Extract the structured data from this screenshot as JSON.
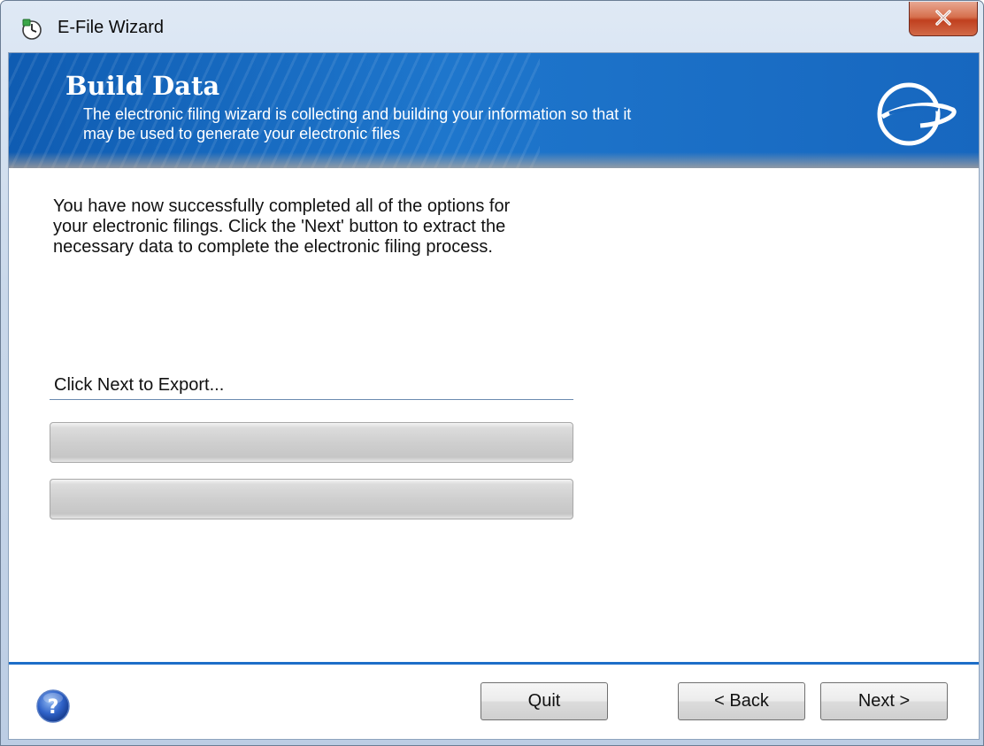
{
  "window": {
    "title": "E-File Wizard",
    "close_glyph": "X"
  },
  "banner": {
    "title": "Build Data",
    "subtitle_line1": "The electronic filing wizard is collecting and building your information so that it",
    "subtitle_line2": "may be used to generate your electronic files",
    "logo_icon": "efile-logo-icon"
  },
  "main": {
    "intro_line1": "You have now successfully completed all of the options for",
    "intro_line2": "your electronic filings.  Click the 'Next' button to extract the",
    "intro_line3": "necessary data to complete the electronic filing process.",
    "status": "Click Next to Export...",
    "progress_bars": [
      {
        "value_percent": 0
      },
      {
        "value_percent": 0
      }
    ]
  },
  "footer": {
    "help_icon": "help-icon",
    "quit_label": "Quit",
    "back_label": "< Back",
    "next_label": "Next >"
  },
  "colors": {
    "banner_blue": "#1767bf",
    "footer_rule": "#1e6ec8",
    "close_red": "#c0401f"
  }
}
